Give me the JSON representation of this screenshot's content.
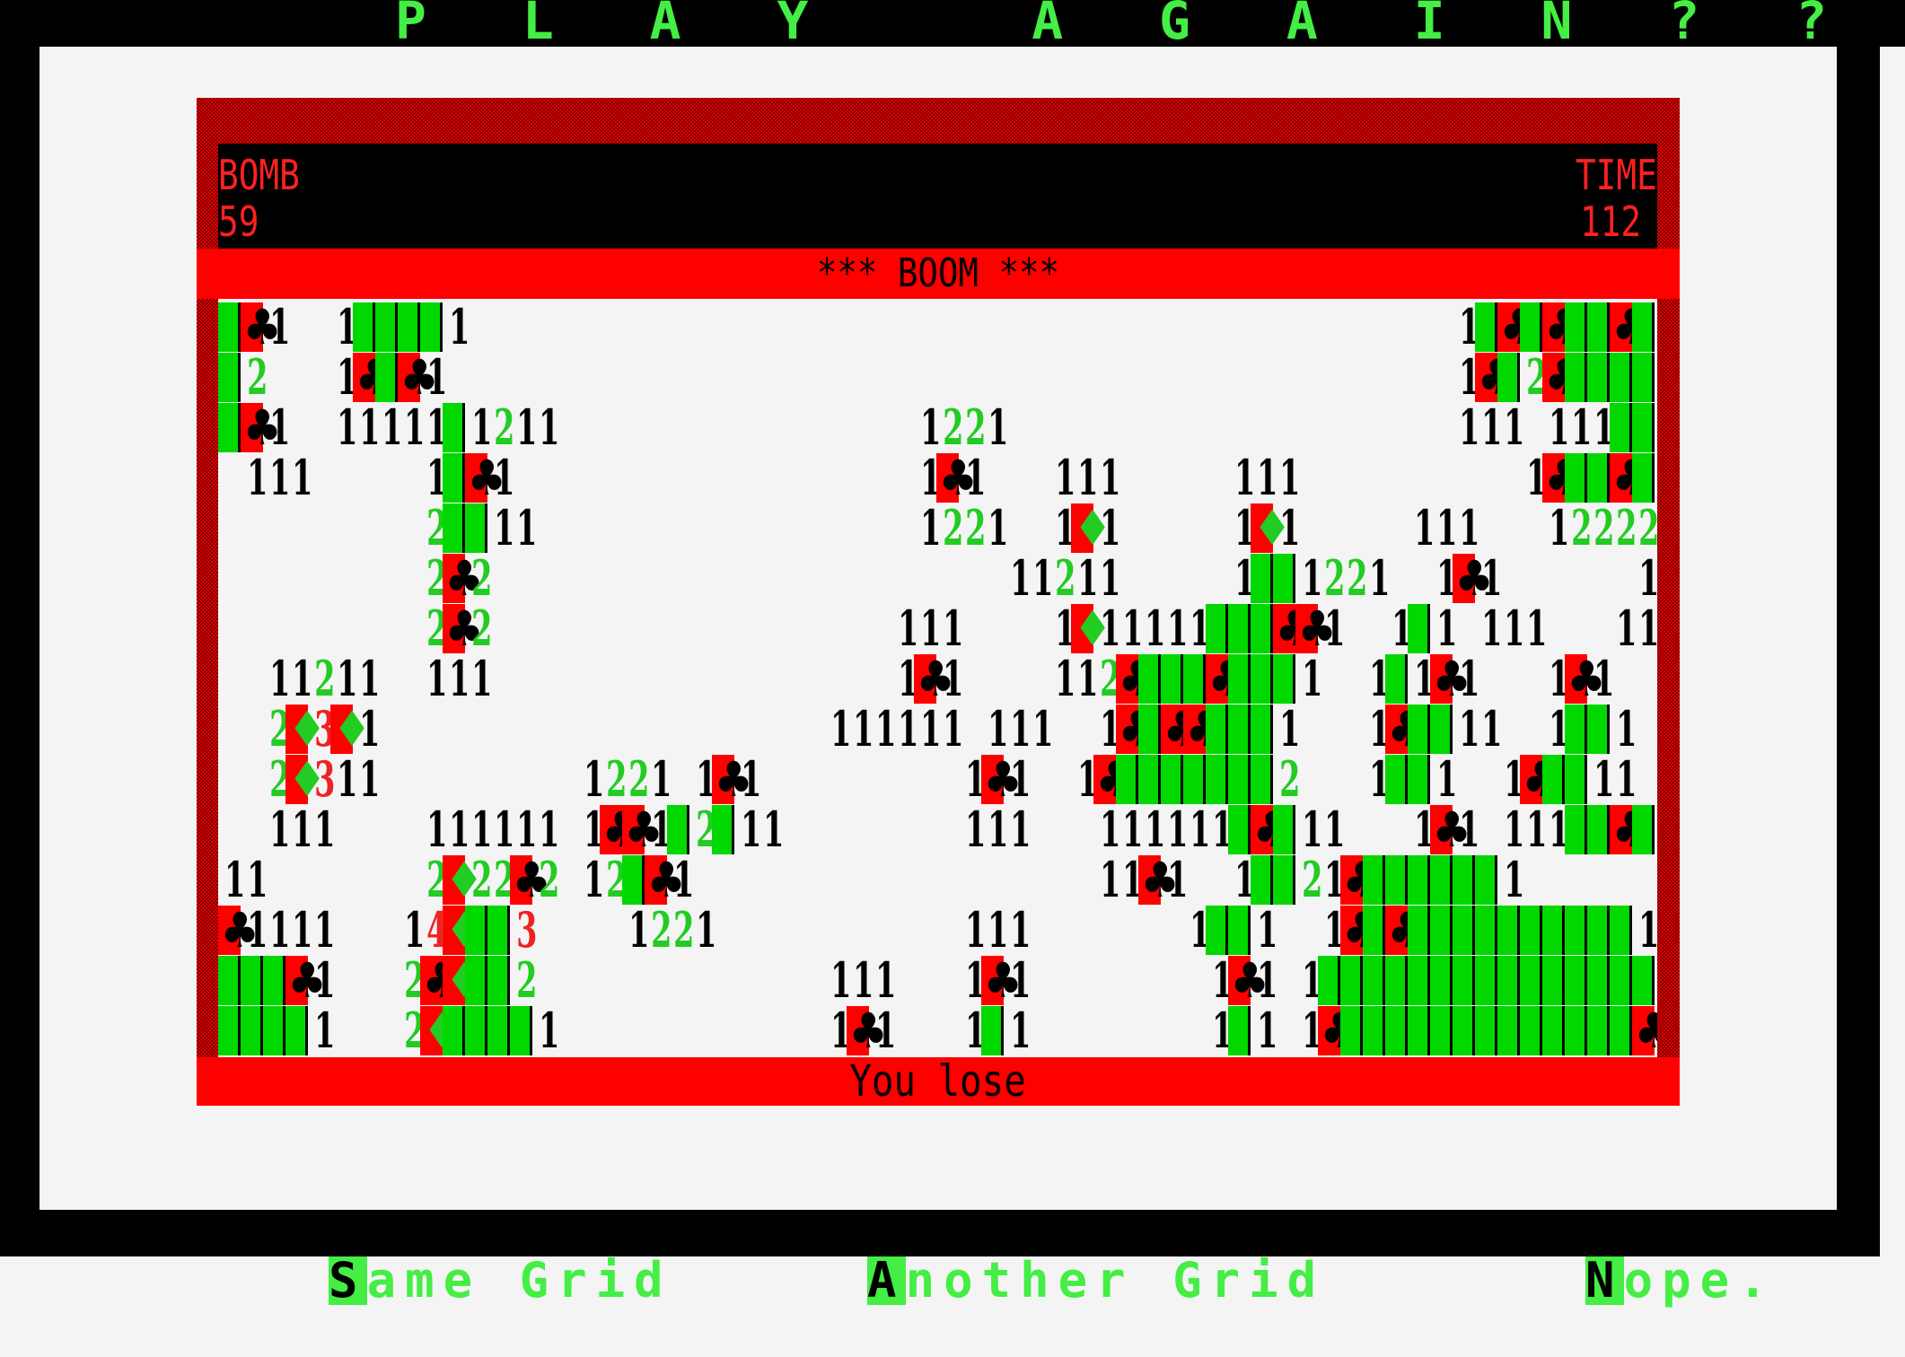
{
  "title": "P L A Y   A G A I N ? ? ?",
  "info": {
    "bomb_label": "BOMB",
    "bomb_count": "59",
    "time_label": "TIME",
    "time_value": "112"
  },
  "status": "*** BOOM ***",
  "result": "You lose",
  "menu": [
    {
      "key": "S",
      "rest": "ame Grid"
    },
    {
      "key": "A",
      "rest": "nother Grid"
    },
    {
      "key": "N",
      "rest": "ope."
    }
  ],
  "colors": {
    "accent_green": "#44ee44",
    "cell_green": "#00d800",
    "alert_red": "#ff0000",
    "frame_dark_red": "#7a0000",
    "number_color": "#000000",
    "hint_green": "#22cc22",
    "hint_red": "#ee2222"
  },
  "board": {
    "columns": 64,
    "rows": 15,
    "legend": {
      "#": "unrevealed",
      "X": "mine",
      "F": "wrong flag",
      "1-4": "revealed count",
      ".": "revealed empty"
    },
    "grid": [
      "#X1..1####1............................................1#X#X##X##X#",
      "#2...1X#X1.............................................1X#2X#######",
      "#X1..11111#1211................1221....................111.111######",
      ".111.....1#X1..................1X1...111.....111..........1X##X##",
      ".........2##11.................1221..1F1.....1F1.....111...12222##",
      ".........2X2.......................11211.....1##1221..1X1......1X#",
      ".........2X2..................111....1F11111###XX1..1#1.111...111.111",
      "..11211..111..................1X1....112X###X###1..1#1X1...1X1....",
      "..2F3F1....................111111.111..1X#XX###1...1X##11..1##1...",
      "..2F311.........1221.1X1.........1X1..1X#######2...1##1..1X##11...",
      "..111....111111.1XX1#2#11........111...111111#X#11...1X1.111##X#1..",
      "11.......2F22X2.12#X1..................11X1..1##21X######1...",
      "X1111...14F##3....1221...........111.......1##1..1X#X##########11",
      "###X1...2XF##2.............111...1X1........1X1.1###############X",
      "####1...2F####1............1X1...1#1........1#1.1X#############X##"
    ]
  }
}
